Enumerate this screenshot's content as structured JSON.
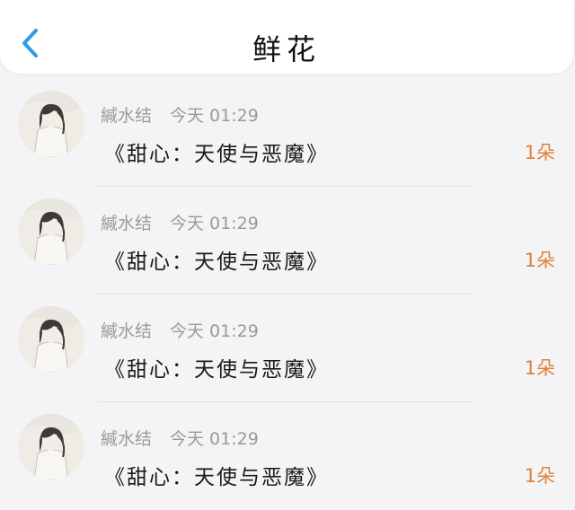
{
  "header": {
    "title": "鲜花",
    "back_icon": "chevron-left-icon",
    "accent_color": "#2f9be6"
  },
  "gifts": [
    {
      "username": "緘水结",
      "time": "今天 01:29",
      "gift_title": "《甜心：天使与恶魔》",
      "count": "1朵"
    },
    {
      "username": "緘水结",
      "time": "今天 01:29",
      "gift_title": "《甜心：天使与恶魔》",
      "count": "1朵"
    },
    {
      "username": "緘水结",
      "time": "今天 01:29",
      "gift_title": "《甜心：天使与恶魔》",
      "count": "1朵"
    },
    {
      "username": "緘水结",
      "time": "今天 01:29",
      "gift_title": "《甜心：天使与恶魔》",
      "count": "1朵"
    }
  ],
  "colors": {
    "count": "#e0823a",
    "meta": "#9a9a9a"
  }
}
